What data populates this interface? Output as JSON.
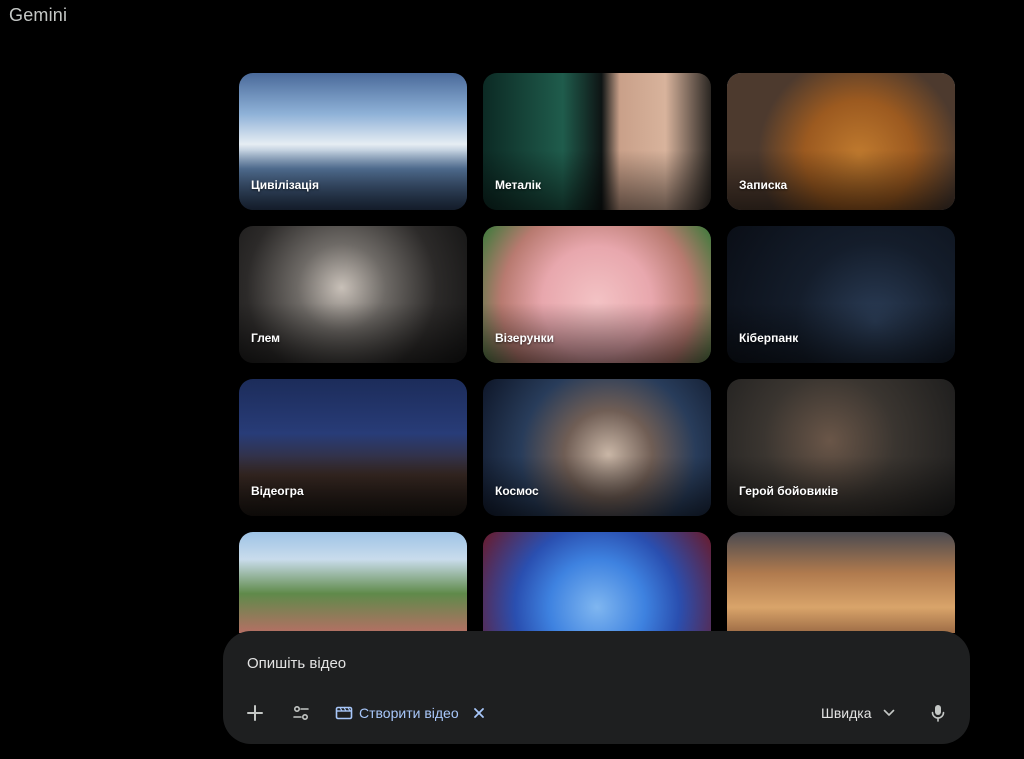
{
  "app": {
    "title": "Gemini"
  },
  "gallery": {
    "tiles": [
      {
        "label": "Цивілізація"
      },
      {
        "label": "Металік"
      },
      {
        "label": "Записка"
      },
      {
        "label": "Глем"
      },
      {
        "label": "Візерунки"
      },
      {
        "label": "Кіберпанк"
      },
      {
        "label": "Відеогра"
      },
      {
        "label": "Космос"
      },
      {
        "label": "Герой бойовиків"
      },
      {
        "label": ""
      },
      {
        "label": ""
      },
      {
        "label": ""
      }
    ]
  },
  "prompt": {
    "placeholder": "Опишіть відео",
    "chip_label": "Створити відео",
    "model_label": "Швидка",
    "icons": {
      "add": "plus-icon",
      "tools": "tune-icon",
      "chip": "movie-icon",
      "chip_close": "close-icon",
      "model_dropdown": "chevron-down-icon",
      "mic": "microphone-icon"
    },
    "accent_color": "#a8c7fa"
  }
}
